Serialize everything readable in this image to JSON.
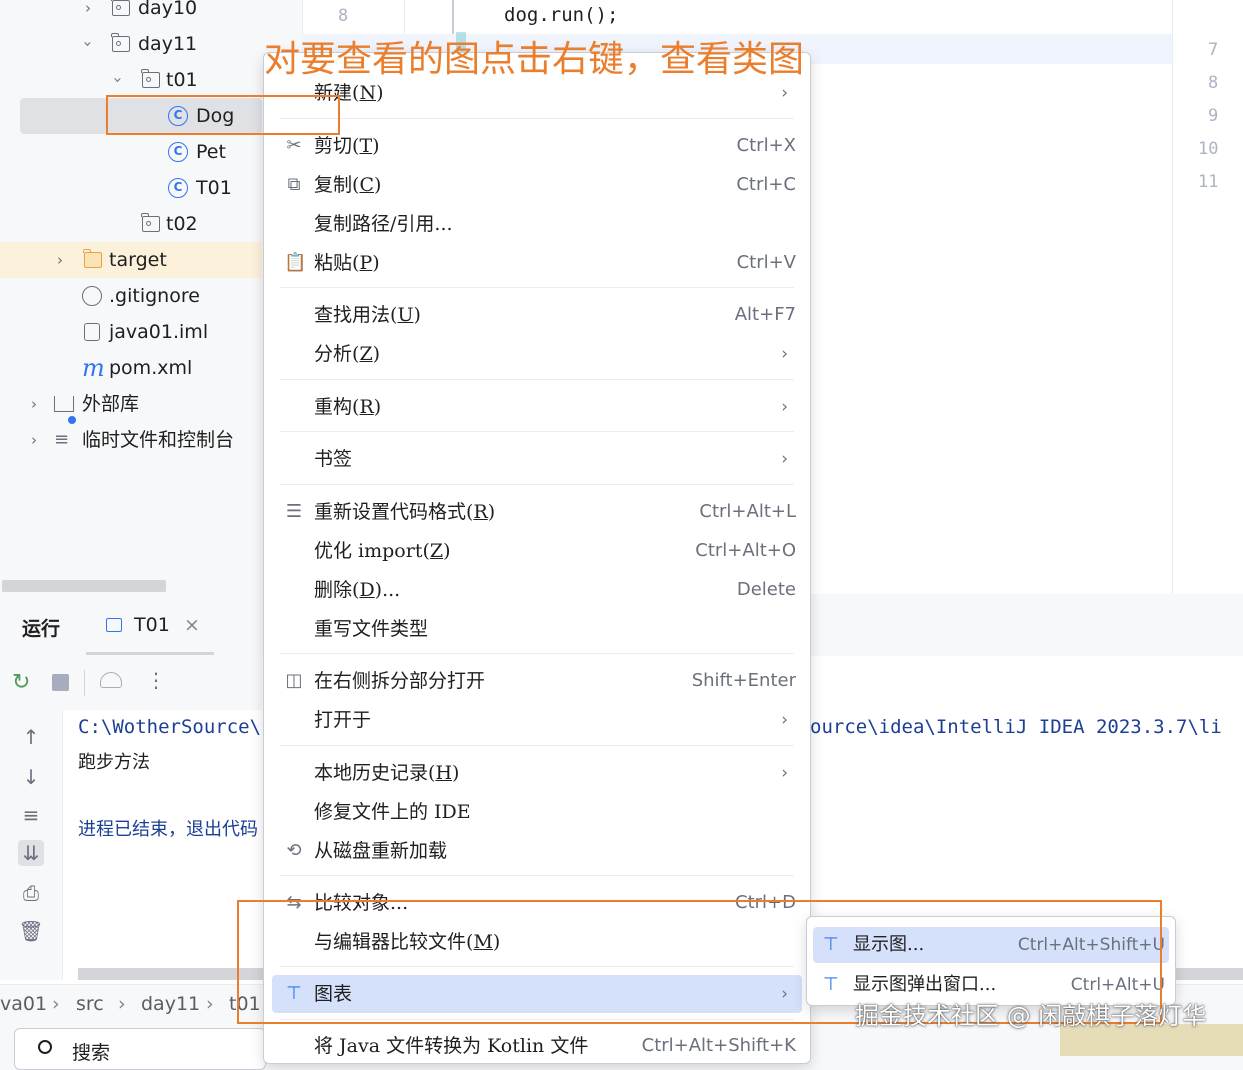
{
  "tree": {
    "items": [
      {
        "label": "day10"
      },
      {
        "label": "day11"
      },
      {
        "label": "t01"
      },
      {
        "label": "Dog"
      },
      {
        "label": "Pet"
      },
      {
        "label": "T01"
      },
      {
        "label": "t02"
      },
      {
        "label": "target"
      },
      {
        "label": ".gitignore"
      },
      {
        "label": "java01.iml"
      },
      {
        "label": "pom.xml"
      },
      {
        "label": "外部库"
      },
      {
        "label": "临时文件和控制台"
      }
    ]
  },
  "editor": {
    "code_line": "dog.run();",
    "line_top": "8",
    "right_gutter": [
      "7",
      "8",
      "9",
      "10",
      "11"
    ]
  },
  "run": {
    "tab_run": "运行",
    "tab_file": "T01",
    "close": "×",
    "console_path_left": "C:\\WotherSource\\",
    "console_path_right": "ource\\idea\\IntelliJ IDEA 2023.3.7\\li",
    "console_line2": "跑步方法",
    "console_line3": "进程已结束，退出代码"
  },
  "status": {
    "crumbs": [
      "va01",
      "src",
      "day11",
      "t01"
    ],
    "search": "搜索"
  },
  "menu": {
    "items": [
      {
        "label": "新建",
        "key": "N",
        "shortcut": "",
        "submenu": true
      },
      {
        "label": "剪切",
        "key": "T",
        "shortcut": "Ctrl+X"
      },
      {
        "label": "复制",
        "key": "C",
        "shortcut": "Ctrl+C"
      },
      {
        "label": "复制路径/引用...",
        "key": "",
        "shortcut": ""
      },
      {
        "label": "粘贴",
        "key": "P",
        "shortcut": "Ctrl+V"
      },
      {
        "label": "查找用法",
        "key": "U",
        "shortcut": "Alt+F7"
      },
      {
        "label": "分析",
        "key": "Z",
        "shortcut": "",
        "submenu": true
      },
      {
        "label": "重构",
        "key": "R",
        "shortcut": "",
        "submenu": true
      },
      {
        "label": "书签",
        "key": "",
        "shortcut": "",
        "submenu": true
      },
      {
        "label": "重新设置代码格式",
        "key": "R",
        "shortcut": "Ctrl+Alt+L"
      },
      {
        "label": "优化 import",
        "key": "Z",
        "shortcut": "Ctrl+Alt+O"
      },
      {
        "label": "删除",
        "key": "D",
        "suffix": "...",
        "shortcut": "Delete"
      },
      {
        "label": "重写文件类型",
        "key": "",
        "shortcut": ""
      },
      {
        "label": "在右侧拆分部分打开",
        "key": "",
        "shortcut": "Shift+Enter"
      },
      {
        "label": "打开于",
        "key": "",
        "shortcut": "",
        "submenu": true
      },
      {
        "label": "本地历史记录",
        "key": "H",
        "shortcut": "",
        "submenu": true
      },
      {
        "label": "修复文件上的 IDE",
        "key": "",
        "shortcut": ""
      },
      {
        "label": "从磁盘重新加载",
        "key": "",
        "shortcut": ""
      },
      {
        "label": "比较对象...",
        "key": "",
        "shortcut": "Ctrl+D"
      },
      {
        "label": "与编辑器比较文件",
        "key": "M",
        "shortcut": ""
      },
      {
        "label": "图表",
        "key": "",
        "shortcut": "",
        "submenu": true
      },
      {
        "label": "将 Java 文件转换为 Kotlin 文件",
        "key": "",
        "shortcut": "Ctrl+Alt+Shift+K"
      }
    ]
  },
  "submenu": {
    "items": [
      {
        "label": "显示图...",
        "shortcut": "Ctrl+Alt+Shift+U"
      },
      {
        "label": "显示图弹出窗口...",
        "shortcut": "Ctrl+Alt+U"
      }
    ]
  },
  "annotation": "对要查看的图点击右键，查看类图",
  "watermark": "掘金技术社区 @ 闲敲棋子落灯华",
  "colors": {
    "accent": "#3574f0",
    "highlight": "#d5e1fb",
    "annotation": "#ea7e2c"
  }
}
